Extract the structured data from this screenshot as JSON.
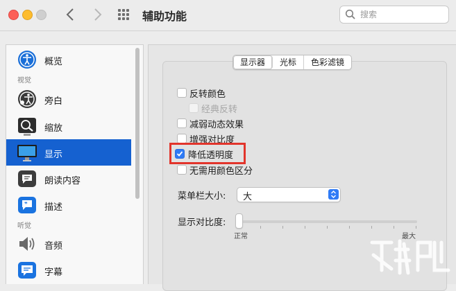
{
  "window": {
    "title": "辅助功能",
    "search_placeholder": "搜索"
  },
  "sidebar": {
    "sections": {
      "vision": "视觉",
      "hearing": "听觉"
    },
    "items": [
      {
        "label": "概览",
        "icon": "accessibility-icon"
      },
      {
        "label": "旁白",
        "icon": "voiceover-icon"
      },
      {
        "label": "缩放",
        "icon": "zoom-icon"
      },
      {
        "label": "显示",
        "icon": "display-icon",
        "selected": true
      },
      {
        "label": "朗读内容",
        "icon": "speech-icon"
      },
      {
        "label": "描述",
        "icon": "descriptions-icon"
      },
      {
        "label": "音频",
        "icon": "audio-icon"
      },
      {
        "label": "字幕",
        "icon": "captions-icon"
      }
    ]
  },
  "tabs": [
    {
      "label": "显示器",
      "active": true
    },
    {
      "label": "光标",
      "active": false
    },
    {
      "label": "色彩滤镜",
      "active": false
    }
  ],
  "options": [
    {
      "label": "反转颜色",
      "checked": false,
      "disabled": false
    },
    {
      "label": "经典反转",
      "checked": false,
      "disabled": true
    },
    {
      "label": "减弱动态效果",
      "checked": false,
      "disabled": false
    },
    {
      "label": "增强对比度",
      "checked": false,
      "disabled": false
    },
    {
      "label": "降低透明度",
      "checked": true,
      "disabled": false
    },
    {
      "label": "无需用颜色区分",
      "checked": false,
      "disabled": false
    }
  ],
  "menu_bar_size": {
    "label": "菜单栏大小:",
    "value": "大"
  },
  "contrast": {
    "label": "显示对比度:",
    "min_label": "正常",
    "max_label": "最大",
    "value": 0
  },
  "colors": {
    "accent": "#2f7bf6",
    "selection": "#1561d0",
    "highlight_box": "#e2342b"
  }
}
